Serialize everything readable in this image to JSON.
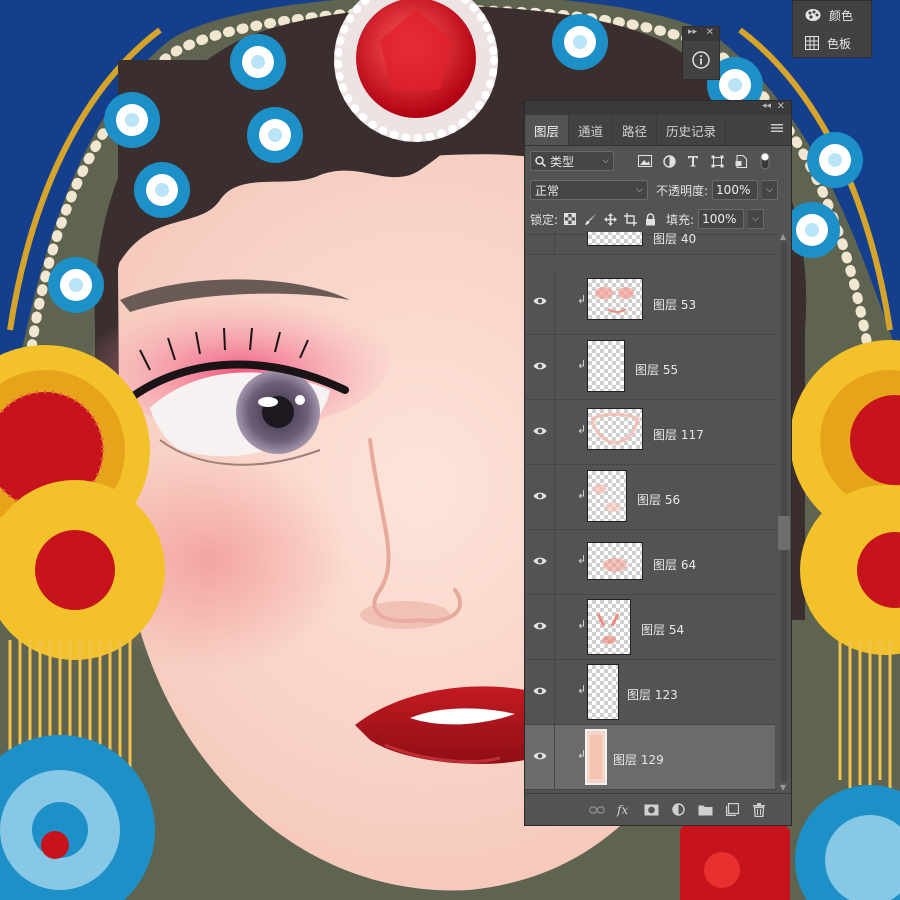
{
  "mini_panel": {
    "items": [
      {
        "label": "颜色",
        "icon": "color-palette-icon"
      },
      {
        "label": "色板",
        "icon": "swatches-grid-icon"
      }
    ]
  },
  "info_panel": {
    "icon": "info-icon"
  },
  "layers_panel": {
    "tabs": [
      {
        "label": "图层",
        "active": true
      },
      {
        "label": "通道",
        "active": false
      },
      {
        "label": "路径",
        "active": false
      },
      {
        "label": "历史记录",
        "active": false
      }
    ],
    "filter": {
      "kind_label": "类型"
    },
    "blend_mode": "正常",
    "opacity_label": "不透明度:",
    "opacity_value": "100%",
    "lock_label": "锁定:",
    "fill_label": "填充:",
    "fill_value": "100%",
    "layers": [
      {
        "name": "图层 40",
        "selected": false
      },
      {
        "name": "图层 53",
        "selected": false
      },
      {
        "name": "图层 55",
        "selected": false
      },
      {
        "name": "图层 117",
        "selected": false
      },
      {
        "name": "图层 56",
        "selected": false
      },
      {
        "name": "图层 64",
        "selected": false
      },
      {
        "name": "图层 54",
        "selected": false
      },
      {
        "name": "图层 123",
        "selected": false
      },
      {
        "name": "图层 129",
        "selected": true
      }
    ]
  },
  "colors": {
    "panel_bg": "#535353",
    "panel_dark": "#424242",
    "selected_row": "#6b6b6b",
    "lip_red": "#b3161c",
    "eyeshadow_pink": "#f0627e",
    "flower_yellow": "#f3c12a",
    "ornament_blue": "#1e90c8",
    "background_olive": "#5e6450"
  }
}
